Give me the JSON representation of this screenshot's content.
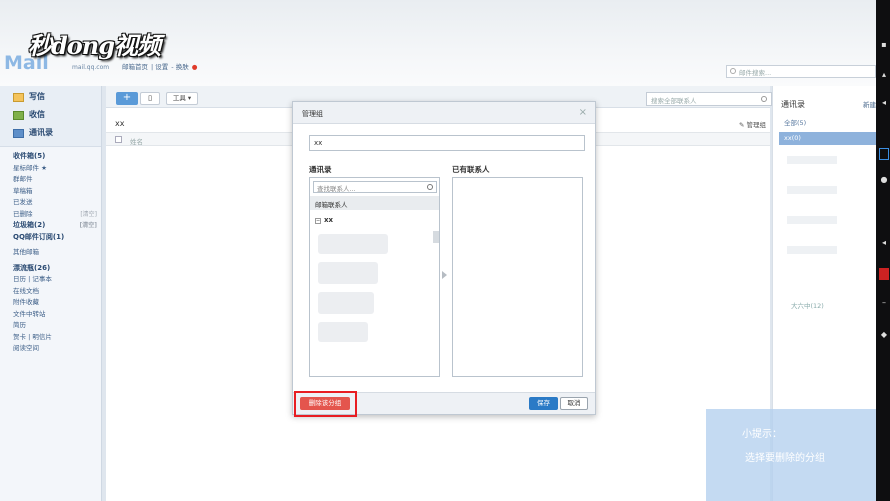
{
  "watermark": "秒dong视频",
  "header": {
    "logo": "Mail",
    "logo_sub": "mail.qq.com",
    "links": [
      "邮箱首页",
      "设置",
      "换肤"
    ],
    "mail_search_placeholder": "邮件搜索..."
  },
  "sidebar": {
    "actions": [
      {
        "label": "写信",
        "icon": "write-icon"
      },
      {
        "label": "收信",
        "icon": "inbox-icon"
      },
      {
        "label": "通讯录",
        "icon": "contacts-icon"
      }
    ],
    "folders": [
      {
        "label": "收件箱(5)",
        "bold": true
      },
      {
        "label": "星标邮件 ★"
      },
      {
        "label": "群邮件"
      },
      {
        "label": "草稿箱"
      },
      {
        "label": "已发送"
      },
      {
        "label": "已删除",
        "aside": "[清空]"
      },
      {
        "label": "垃圾箱(2)",
        "bold": true,
        "aside": "[清空]"
      },
      {
        "label": "QQ邮件订阅(1)",
        "bold": true
      },
      {
        "label": "其他邮箱",
        "gap": true
      },
      {
        "label": "漂流瓶(26)",
        "bold": true,
        "gap": true
      },
      {
        "label": "日历 | 记事本"
      },
      {
        "label": "在线文档"
      },
      {
        "label": "附件收藏"
      },
      {
        "label": "文件中转站"
      },
      {
        "label": "简历"
      },
      {
        "label": "贺卡 | 明信片"
      },
      {
        "label": "阅读空间"
      }
    ]
  },
  "main": {
    "add_label": "+",
    "tools_label": "工具 ▾",
    "contact_search_placeholder": "搜索全部联系人",
    "group_title": "xx",
    "manage_group": "管理组",
    "name_header": "姓名"
  },
  "rightpanel": {
    "title": "通讯录",
    "new_label": "新建",
    "items": [
      "全部(5)",
      "xx(0)"
    ],
    "bottom": "大六中(12)"
  },
  "dialog": {
    "title": "管理组",
    "close": "×",
    "group_name": "xx",
    "left_label": "通讯录",
    "right_label": "已有联系人",
    "find_placeholder": "查找联系人...",
    "subheader": "邮箱联系人",
    "group_item": "xx",
    "delete_label": "删除该分组",
    "save_label": "保存",
    "cancel_label": "取消"
  },
  "tip": {
    "title": "小提示：",
    "text": "选择要删除的分组"
  },
  "colors": {
    "accent": "#2a7ac6",
    "delete": "#e4554d",
    "highlight_frame": "#e81d22"
  }
}
